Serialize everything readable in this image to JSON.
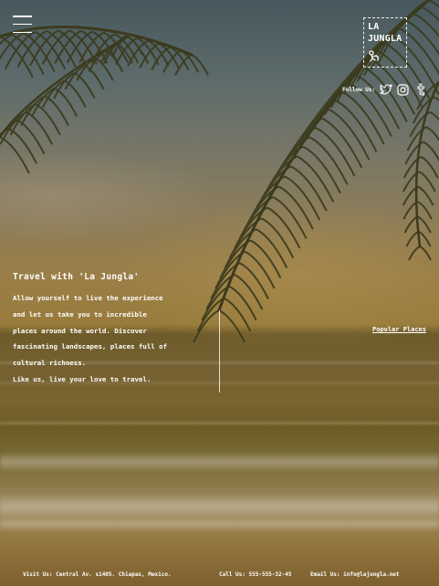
{
  "brand": {
    "line1": "LA",
    "line2": "JUNGLA"
  },
  "header": {
    "follow_label": "Follow Us:",
    "social": [
      "twitter-icon",
      "instagram-icon",
      "tumblr-icon"
    ]
  },
  "intro": {
    "title": "Travel with 'La Jungla'",
    "lines": [
      "Allow yourself to live the experience",
      "and let us take you to incredible",
      "places around the world. Discover",
      "fascinating landscapes, places full of",
      "cultural richness.",
      "Like us, live your love to travel."
    ]
  },
  "popular_link": "Popular Places",
  "footer": {
    "visit": "Visit Us: Central Av. s1405. Chiapas, Mexico.",
    "call": "Call Us: 555-555-32-45",
    "email": "Email Us: info@lajungla.net"
  }
}
